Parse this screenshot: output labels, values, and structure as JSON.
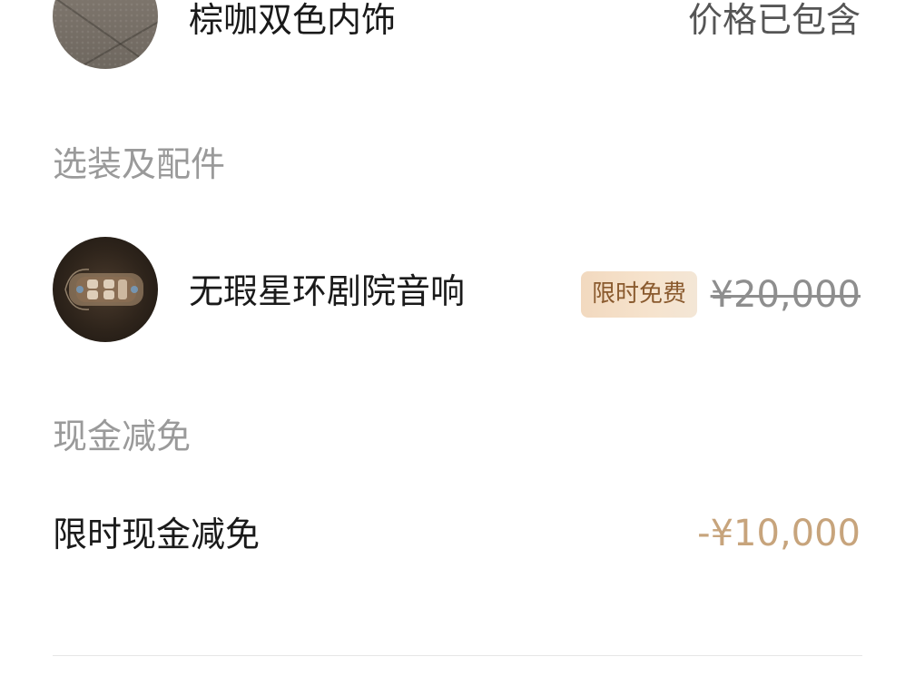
{
  "interior": {
    "title": "棕咖双色内饰",
    "price_note": "价格已包含"
  },
  "options_section": {
    "heading": "选装及配件",
    "items": [
      {
        "title": "无瑕星环剧院音响",
        "badge": "限时免费",
        "original_price": "¥20,000"
      }
    ]
  },
  "cash_section": {
    "heading": "现金减免",
    "items": [
      {
        "title": "限时现金减免",
        "value": "-¥10,000"
      }
    ]
  },
  "colors": {
    "accent_gold": "#c7a47c",
    "badge_bg": "#f3dfc8",
    "badge_text": "#8a5a2e",
    "muted_text": "#9a9a9a"
  },
  "icons": {
    "interior_thumbnail": "interior-material-swatch-image",
    "audio_thumbnail": "car-cutaway-audio-image"
  }
}
